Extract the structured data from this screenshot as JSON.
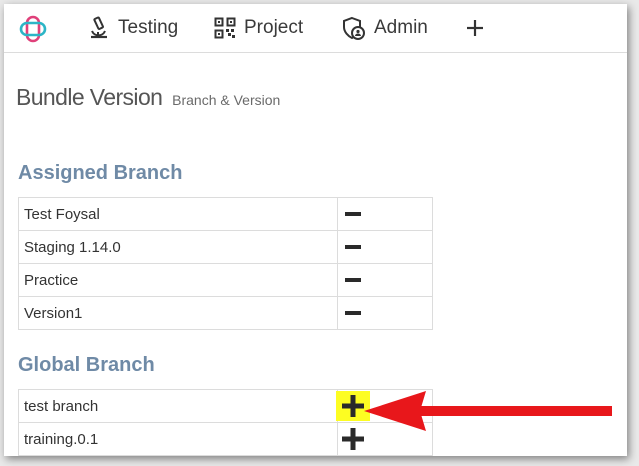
{
  "nav": {
    "items": [
      {
        "label": "Testing",
        "icon": "microscope-icon"
      },
      {
        "label": "Project",
        "icon": "qr-code-icon"
      },
      {
        "label": "Admin",
        "icon": "shield-user-icon"
      }
    ],
    "add_icon": "plus-icon",
    "logo_icon": "app-logo-icon"
  },
  "page": {
    "title": "Bundle Version",
    "subtitle": "Branch & Version"
  },
  "assigned_branch": {
    "heading": "Assigned Branch",
    "rows": [
      {
        "name": "Test Foysal",
        "action": "remove"
      },
      {
        "name": "Staging 1.14.0",
        "action": "remove"
      },
      {
        "name": "Practice",
        "action": "remove"
      },
      {
        "name": "Version1",
        "action": "remove"
      }
    ]
  },
  "global_branch": {
    "heading": "Global Branch",
    "rows": [
      {
        "name": "test branch",
        "action": "add",
        "highlighted": true
      },
      {
        "name": "training.0.1",
        "action": "add"
      }
    ]
  },
  "colors": {
    "heading": "#6f8aa6",
    "highlight": "#fdfd22",
    "arrow": "#e8171b"
  }
}
